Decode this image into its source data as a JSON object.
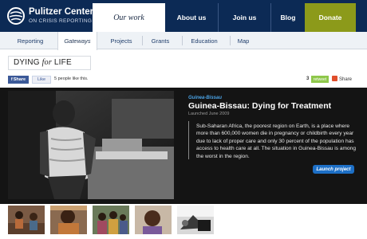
{
  "brand": {
    "name": "Pulitzer Center",
    "tagline": "ON CRISIS REPORTING",
    "colors": {
      "nav_bg": "#0c2a55",
      "donate": "#8c9a1a",
      "accent_link": "#4aa3e6",
      "launch_button": "#1d6fc6"
    }
  },
  "top_nav": {
    "items": [
      {
        "label": "Our work",
        "active": true
      },
      {
        "label": "About us",
        "active": false
      },
      {
        "label": "Join us",
        "active": false
      },
      {
        "label": "Blog",
        "active": false
      },
      {
        "label": "Donate",
        "active": false
      }
    ]
  },
  "sub_nav": {
    "items": [
      {
        "label": "Reporting",
        "active": false
      },
      {
        "label": "Gateways",
        "active": true
      },
      {
        "label": "Projects",
        "active": false
      },
      {
        "label": "Grants",
        "active": false
      },
      {
        "label": "Education",
        "active": false
      },
      {
        "label": "Map",
        "active": false
      }
    ]
  },
  "page": {
    "title_part1": "DYING ",
    "title_part2": "for",
    "title_part3": " LIFE"
  },
  "social": {
    "fb_share_label": "Share",
    "fb_like_label": "Like",
    "like_text": "5 people like this.",
    "count": "3",
    "retweet_label": "retweet",
    "share_label": "Share"
  },
  "feature": {
    "kicker": "Guinea-Bissau",
    "headline": "Guinea-Bissau: Dying for Treatment",
    "launched": "Launched June 2009",
    "description": "Sub-Saharan Africa, the poorest region on Earth, is a place where more than 600,000 women die in pregnancy or childbirth every year due to lack of proper care and only 30 percent of the population has access to health care at all. The situation in Guinea-Bissau is among the worst in the region.",
    "launch_button": "Launch project"
  },
  "thumbnails": [
    {
      "icon": "photo-thumbnail"
    },
    {
      "icon": "photo-thumbnail"
    },
    {
      "icon": "photo-thumbnail"
    },
    {
      "icon": "photo-thumbnail"
    },
    {
      "icon": "photo-thumbnail"
    }
  ]
}
